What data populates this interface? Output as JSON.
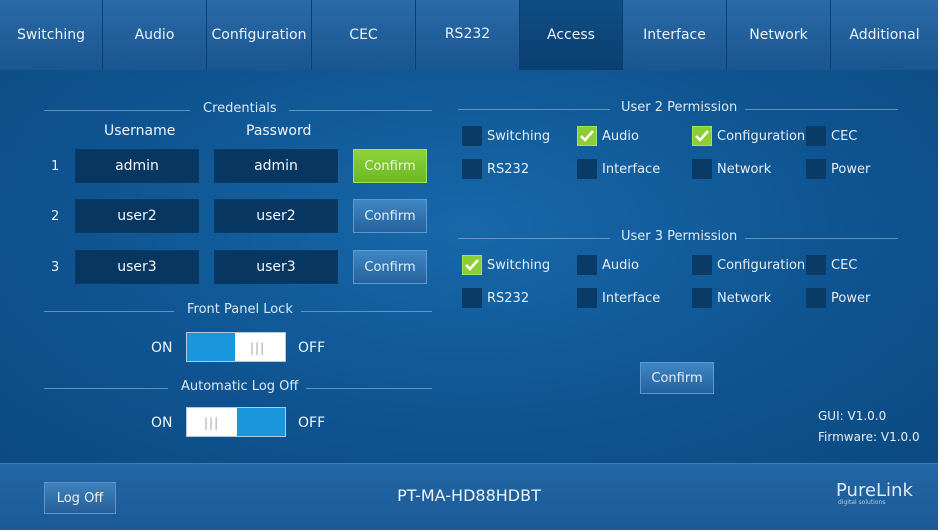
{
  "tabs": [
    {
      "label": "Switching"
    },
    {
      "label": "Audio"
    },
    {
      "label": "Configuration"
    },
    {
      "label": "CEC"
    },
    {
      "label": "RS232"
    },
    {
      "label": "Access"
    },
    {
      "label": "Interface"
    },
    {
      "label": "Network"
    },
    {
      "label": "Additional"
    }
  ],
  "active_tab": "Access",
  "credentials": {
    "title": "Credentials",
    "username_header": "Username",
    "password_header": "Password",
    "rows": [
      {
        "num": "1",
        "username": "admin",
        "password": "admin",
        "confirm": "Confirm",
        "highlighted": true
      },
      {
        "num": "2",
        "username": "user2",
        "password": "user2",
        "confirm": "Confirm",
        "highlighted": false
      },
      {
        "num": "3",
        "username": "user3",
        "password": "user3",
        "confirm": "Confirm",
        "highlighted": false
      }
    ]
  },
  "front_panel_lock": {
    "title": "Front Panel Lock",
    "on": "ON",
    "off": "OFF",
    "state": "ON"
  },
  "auto_log_off": {
    "title": "Automatic Log Off",
    "on": "ON",
    "off": "OFF",
    "state": "OFF"
  },
  "user2_permission": {
    "title": "User 2 Permission",
    "items": [
      {
        "label": "Switching",
        "checked": false
      },
      {
        "label": "Audio",
        "checked": true
      },
      {
        "label": "Configuration",
        "checked": true
      },
      {
        "label": "CEC",
        "checked": false
      },
      {
        "label": "RS232",
        "checked": false
      },
      {
        "label": "Interface",
        "checked": false
      },
      {
        "label": "Network",
        "checked": false
      },
      {
        "label": "Power",
        "checked": false
      }
    ]
  },
  "user3_permission": {
    "title": "User 3 Permission",
    "items": [
      {
        "label": "Switching",
        "checked": true
      },
      {
        "label": "Audio",
        "checked": false
      },
      {
        "label": "Configuration",
        "checked": false
      },
      {
        "label": "CEC",
        "checked": false
      },
      {
        "label": "RS232",
        "checked": false
      },
      {
        "label": "Interface",
        "checked": false
      },
      {
        "label": "Network",
        "checked": false
      },
      {
        "label": "Power",
        "checked": false
      }
    ]
  },
  "permissions_confirm": "Confirm",
  "version": {
    "gui": "GUI: V1.0.0",
    "firmware": "Firmware: V1.0.0"
  },
  "footer": {
    "logoff": "Log Off",
    "model": "PT-MA-HD88HDBT",
    "brand": "PureLink",
    "brand_tagline": "digital solutions"
  },
  "colors": {
    "accent_green": "#8ccf34",
    "toggle_blue": "#1996dc",
    "background": "#0f5592"
  }
}
